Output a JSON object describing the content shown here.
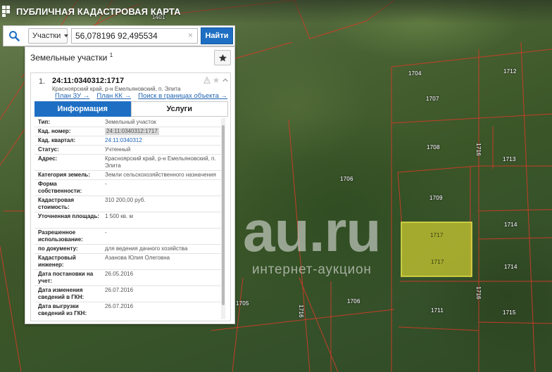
{
  "app": {
    "title": "ПУБЛИЧНАЯ КАДАСТРОВАЯ КАРТА"
  },
  "search": {
    "type_label": "Участки",
    "query": "56,078196 92,495534",
    "clear_glyph": "×",
    "button_label": "Найти"
  },
  "panel": {
    "title": "Земельные участки",
    "title_count": "1",
    "result": {
      "index": "1.",
      "cad_number": "24:11:0340312:1717",
      "address": "Красноярский край, р-н Емельяновский, п. Элита",
      "links": [
        "План ЗУ →",
        "План КК →",
        "Поиск в границах объекта →"
      ]
    },
    "tabs": [
      "Информация",
      "Услуги"
    ],
    "attributes": [
      {
        "key": "Тип:",
        "value": "Земельный участок"
      },
      {
        "key": "Кад. номер:",
        "value": "24:11:0340312:1717"
      },
      {
        "key": "Кад. квартал:",
        "value": "24:11:0340312"
      },
      {
        "key": "Статус:",
        "value": "Учтенный"
      },
      {
        "key": "Адрес:",
        "value": "Красноярский край, р-н Емельяновский, п. Элита"
      },
      {
        "key": "Категория земель:",
        "value": "Земли сельскохозяйственного назначения"
      },
      {
        "key": "Форма собственности:",
        "value": "-"
      },
      {
        "key": "Кадастровая стоимость:",
        "value": "310 200,00 руб."
      },
      {
        "key": "Уточненная площадь:",
        "value": "1 500 кв. м"
      },
      {
        "key": "Разрешенное использование:",
        "value": "-"
      },
      {
        "key": "по документу:",
        "value": "для ведения дачного хозяйства"
      },
      {
        "key": "Кадастровый инженер:",
        "value": "Азанова Юлия Олеговна"
      },
      {
        "key": "Дата постановки на учет:",
        "value": "26.05.2016"
      },
      {
        "key": "Дата изменения сведений в ГКН:",
        "value": "26.07.2016"
      },
      {
        "key": "Дата выгрузки сведений из ГКН:",
        "value": "26.07.2016"
      }
    ]
  },
  "map": {
    "parcel_labels": [
      "1401",
      "1704",
      "1712",
      "1707",
      "1708",
      "1716",
      "1713",
      "1706",
      "1709",
      "1717",
      "1717",
      "1714",
      "1714",
      "1705",
      "1716",
      "1706",
      "1711",
      "1716",
      "1715",
      "1716"
    ],
    "selected_fill": "#c8c832",
    "boundary_color": "#d23c28"
  },
  "watermark": {
    "main": "au.ru",
    "sub": "интернет-аукцион"
  }
}
